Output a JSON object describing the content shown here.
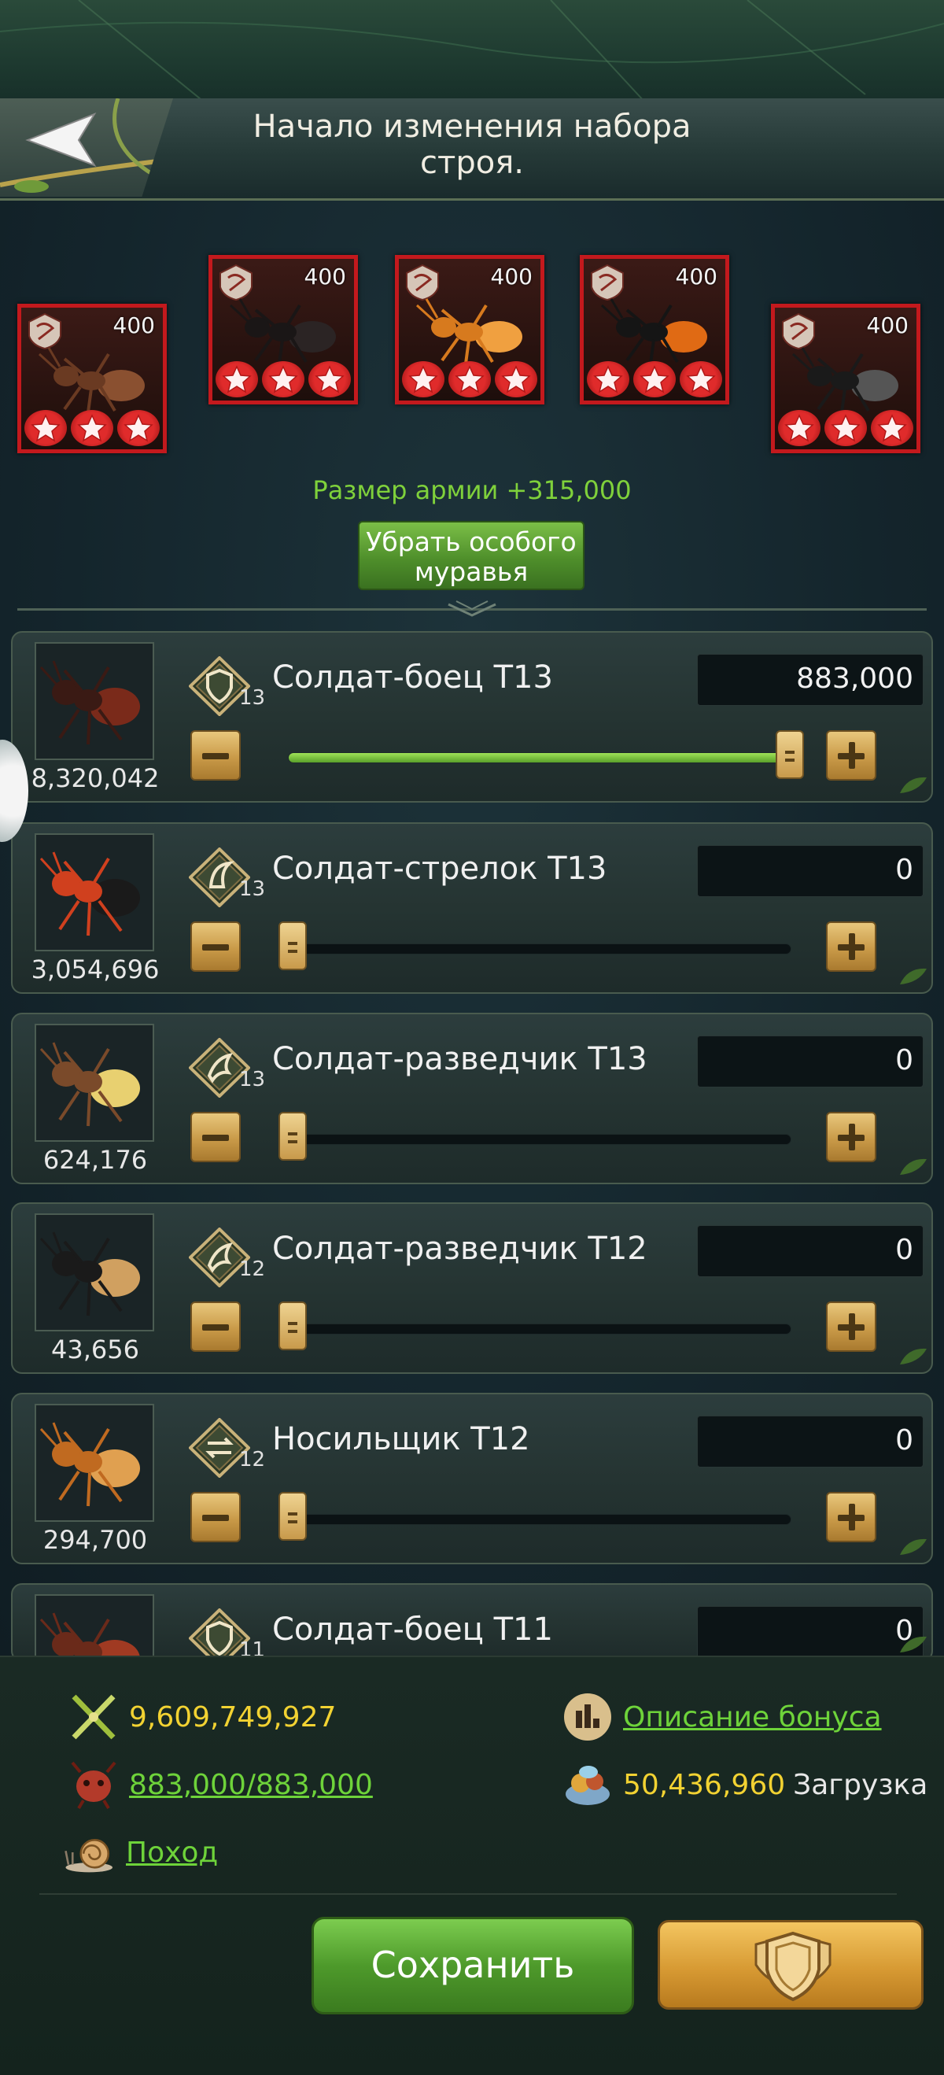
{
  "header": {
    "title": "Начало изменения набора строя."
  },
  "special_ants": [
    {
      "count": "400",
      "stars": 3
    },
    {
      "count": "400",
      "stars": 3
    },
    {
      "count": "400",
      "stars": 3
    },
    {
      "count": "400",
      "stars": 3
    },
    {
      "count": "400",
      "stars": 3
    }
  ],
  "army_size": "Размер армии +315,000",
  "remove_special_label": "Убрать особого муравья",
  "troops": [
    {
      "name": "Солдат-боец T13",
      "tier": "13",
      "total": "8,320,042",
      "quantity": "883,000",
      "fill": 1.0
    },
    {
      "name": "Солдат-стрелок T13",
      "tier": "13",
      "total": "3,054,696",
      "quantity": "0",
      "fill": 0
    },
    {
      "name": "Солдат-разведчик T13",
      "tier": "13",
      "total": "624,176",
      "quantity": "0",
      "fill": 0
    },
    {
      "name": "Солдат-разведчик T12",
      "tier": "12",
      "total": "43,656",
      "quantity": "0",
      "fill": 0
    },
    {
      "name": "Носильщик T12",
      "tier": "12",
      "total": "294,700",
      "quantity": "0",
      "fill": 0
    },
    {
      "name": "Солдат-боец T11",
      "tier": "11",
      "total": "",
      "quantity": "0",
      "fill": 0
    }
  ],
  "stats": {
    "power": "9,609,749,927",
    "troop_count": "883,000/883,000",
    "bonus_link": "Описание бонуса",
    "load_value": "50,436,960",
    "load_label": "Загрузка",
    "march_link": "Поход"
  },
  "save_label": "Сохранить",
  "colors": {
    "accent_green": "#7fd13b",
    "gold": "#f2d232",
    "card_red": "#c3191d"
  }
}
